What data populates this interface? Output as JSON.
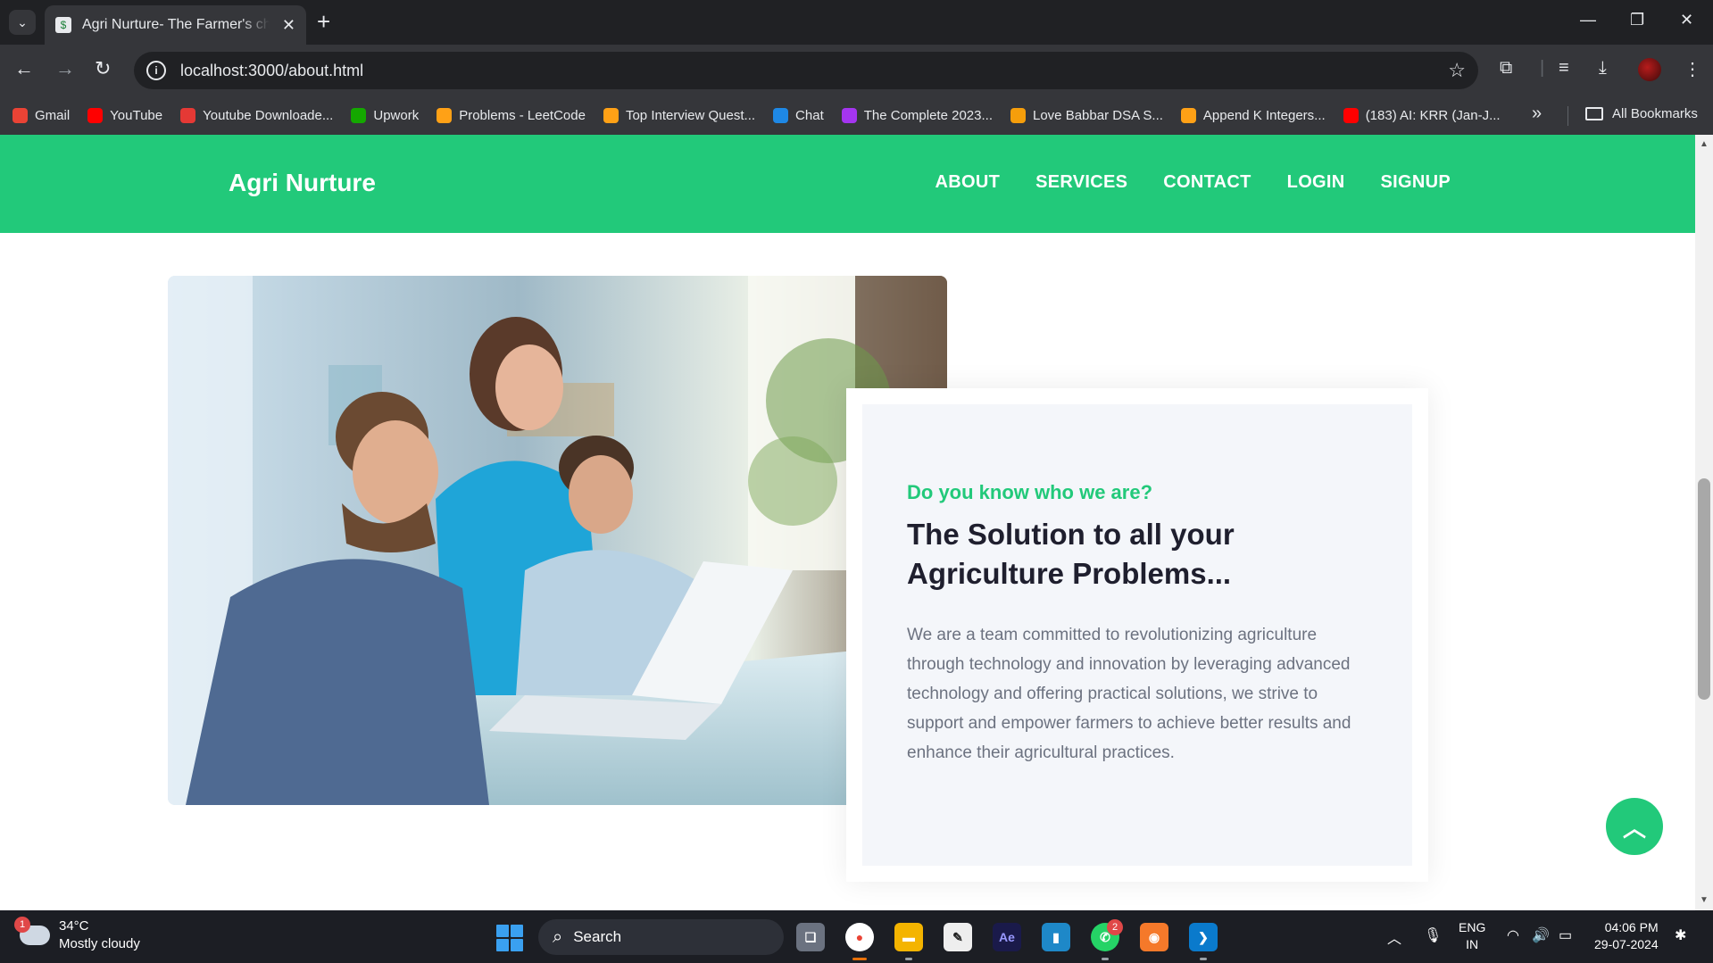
{
  "browser": {
    "tab_title": "Agri Nurture- The Farmer's choice",
    "url": "localhost:3000/about.html",
    "bookmarks": [
      {
        "label": "Gmail",
        "icon": "gmail-icon",
        "color": "#ea4335"
      },
      {
        "label": "YouTube",
        "icon": "youtube-icon",
        "color": "#ff0000"
      },
      {
        "label": "Youtube Downloade...",
        "icon": "download-icon",
        "color": "#e53935"
      },
      {
        "label": "Upwork",
        "icon": "upwork-icon",
        "color": "#14a800"
      },
      {
        "label": "Problems - LeetCode",
        "icon": "leetcode-icon",
        "color": "#ffa116"
      },
      {
        "label": "Top Interview Quest...",
        "icon": "leetcode-icon",
        "color": "#ffa116"
      },
      {
        "label": "Chat",
        "icon": "chat-icon",
        "color": "#1e88e5"
      },
      {
        "label": "The Complete 2023...",
        "icon": "udemy-icon",
        "color": "#a435f0"
      },
      {
        "label": "Love Babbar DSA S...",
        "icon": "bookmark-icon",
        "color": "#f59e0b"
      },
      {
        "label": "Append K Integers...",
        "icon": "leetcode-icon",
        "color": "#ffa116"
      },
      {
        "label": "(183) AI: KRR (Jan-J...",
        "icon": "youtube-icon",
        "color": "#ff0000"
      }
    ],
    "all_bookmarks": "All Bookmarks"
  },
  "site": {
    "brand": "Agri Nurture",
    "nav": [
      "ABOUT",
      "SERVICES",
      "CONTACT",
      "LOGIN",
      "SIGNUP"
    ],
    "accent": "#22c97a"
  },
  "about": {
    "eyebrow": "Do you know who we are?",
    "title": "The Solution to all your Agriculture Problems...",
    "text": "We are a team committed to revolutionizing agriculture through technology and innovation by leveraging advanced technology and offering practical solutions, we strive to support and empower farmers to achieve better results and enhance their agricultural practices."
  },
  "taskbar": {
    "weather_temp": "34°C",
    "weather_desc": "Mostly cloudy",
    "weather_badge": "1",
    "search": "Search",
    "whatsapp_badge": "2",
    "lang_1": "ENG",
    "lang_2": "IN",
    "time": "04:06 PM",
    "date": "29-07-2024"
  }
}
